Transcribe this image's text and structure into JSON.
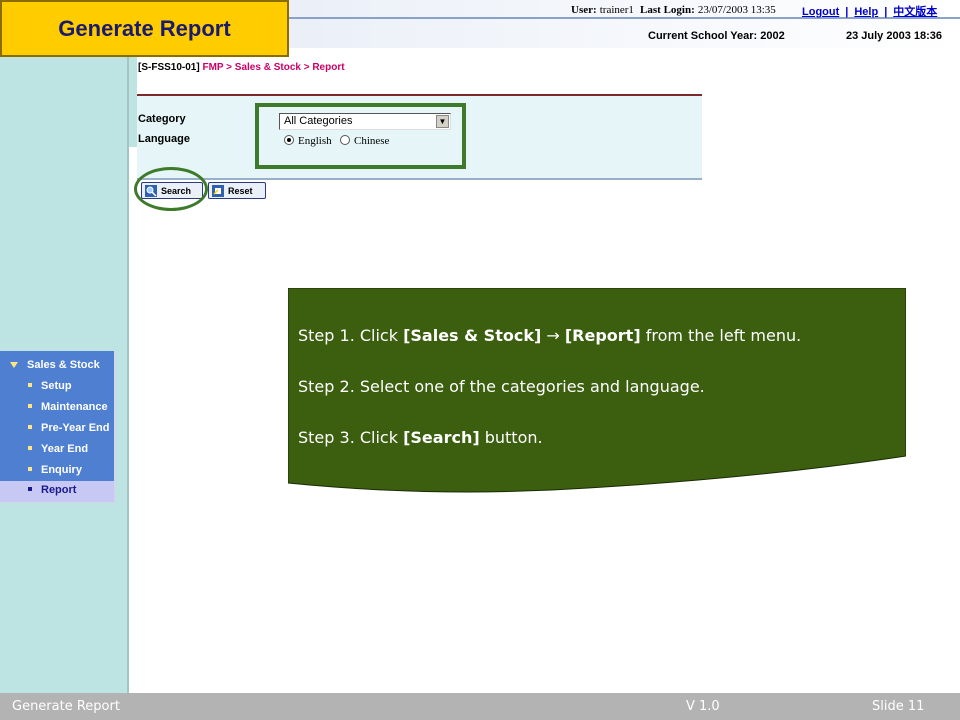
{
  "slide_title": "Generate Report",
  "header": {
    "user_label": "User:",
    "user_value": "trainer1",
    "last_login_label": "Last Login:",
    "last_login_value": "23/07/2003 13:35",
    "logout_link": "Logout",
    "help_link": "Help",
    "chinese_link": "中文版本",
    "school_year": "Current School Year: 2002",
    "date_time": "23 July 2003 18:36"
  },
  "sidebar": {
    "title": "Sales & Stock",
    "items": [
      {
        "label": "Setup"
      },
      {
        "label": "Maintenance"
      },
      {
        "label": "Pre-Year End"
      },
      {
        "label": "Year End"
      },
      {
        "label": "Enquiry"
      },
      {
        "label": "Report",
        "active": true
      }
    ]
  },
  "breadcrumb": {
    "code": "[S-FSS10-01]",
    "path": "FMP > Sales & Stock > Report"
  },
  "form": {
    "category_label": "Category",
    "category_value": "All Categories",
    "language_label": "Language",
    "language_options": [
      {
        "label": "English",
        "selected": true
      },
      {
        "label": "Chinese",
        "selected": false
      }
    ]
  },
  "buttons": {
    "search": "Search",
    "reset": "Reset"
  },
  "callout": {
    "step1_prefix": "Step 1. Click ",
    "step1_b1": "[Sales & Stock]",
    "step1_b2": "[Report]",
    "step1_suffix": " from the left menu.",
    "step2": "Step 2. Select one of the categories and language.",
    "step3_prefix": "Step 3. Click ",
    "step3_b": "[Search]",
    "step3_suffix": " button."
  },
  "footer": {
    "left": "Generate Report",
    "version": "V 1.0",
    "slide": "Slide 11"
  },
  "colors": {
    "title_bg": "#ffcc00",
    "callout_bg": "#3b5e0f",
    "highlight": "#3d7a2a",
    "menu_bg": "#4f7fd0",
    "left_strip": "#bde3e3"
  }
}
